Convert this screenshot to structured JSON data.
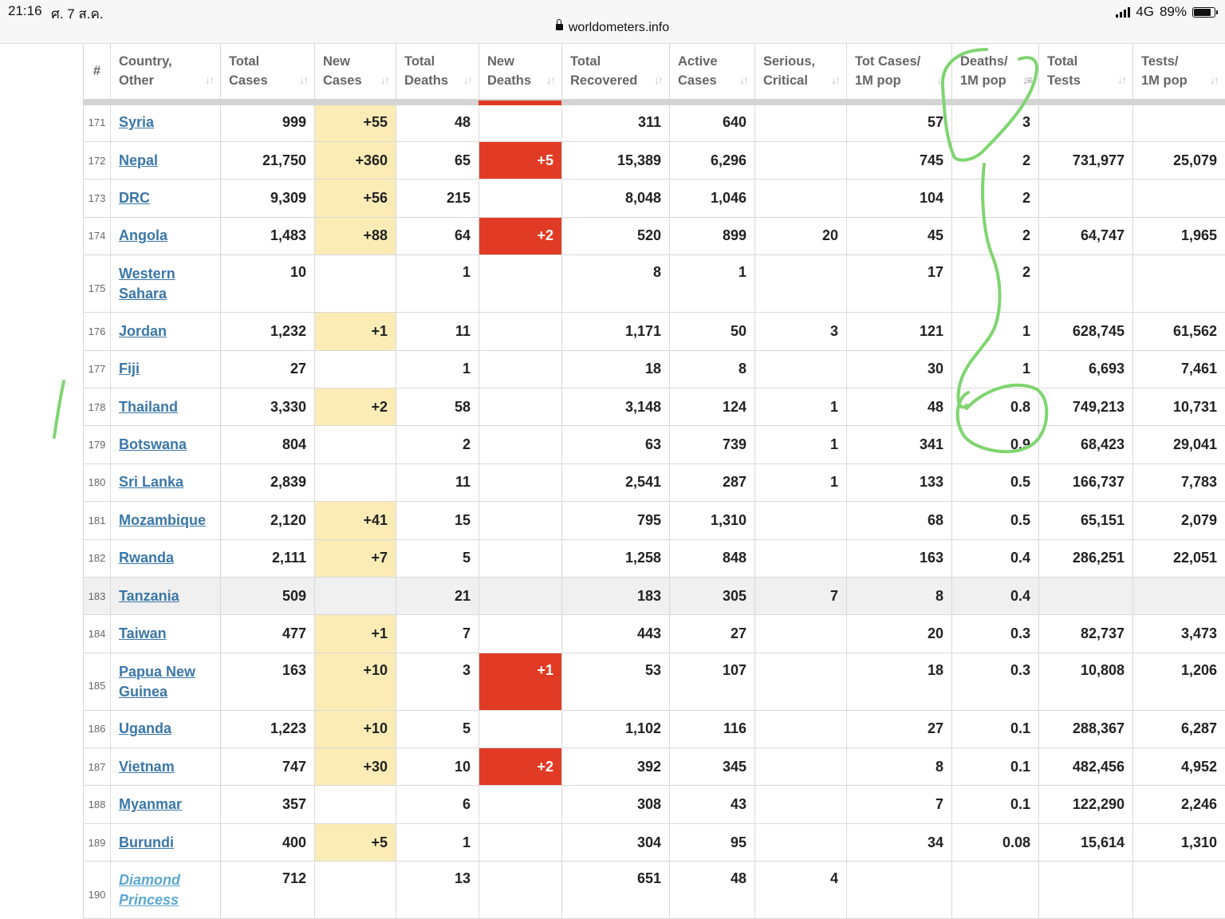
{
  "status": {
    "time": "21:16",
    "date": "ศ. 7 ส.ค.",
    "network": "4G",
    "battery": "89%",
    "battery_level": 0.89
  },
  "browser": {
    "url": "worldometers.info"
  },
  "table": {
    "columns": [
      {
        "lines": [
          "#"
        ]
      },
      {
        "lines": [
          "Country,",
          "Other"
        ]
      },
      {
        "lines": [
          "Total",
          "Cases"
        ]
      },
      {
        "lines": [
          "New",
          "Cases"
        ]
      },
      {
        "lines": [
          "Total",
          "Deaths"
        ]
      },
      {
        "lines": [
          "New",
          "Deaths"
        ]
      },
      {
        "lines": [
          "Total",
          "Recovered"
        ]
      },
      {
        "lines": [
          "Active",
          "Cases"
        ]
      },
      {
        "lines": [
          "Serious,",
          "Critical"
        ]
      },
      {
        "lines": [
          "Tot Cases/",
          "1M pop"
        ]
      },
      {
        "lines": [
          "Deaths/",
          "1M pop"
        ]
      },
      {
        "lines": [
          "Total",
          "Tests"
        ]
      },
      {
        "lines": [
          "Tests/",
          "1M pop"
        ]
      }
    ],
    "rows": [
      {
        "rank": "171",
        "country": "Syria",
        "total_cases": "999",
        "new_cases": "+55",
        "total_deaths": "48",
        "new_deaths": "",
        "total_recovered": "311",
        "active_cases": "640",
        "serious": "",
        "cases_per_m": "57",
        "deaths_per_m": "3",
        "total_tests": "",
        "tests_per_m": ""
      },
      {
        "rank": "172",
        "country": "Nepal",
        "total_cases": "21,750",
        "new_cases": "+360",
        "total_deaths": "65",
        "new_deaths": "+5",
        "total_recovered": "15,389",
        "active_cases": "6,296",
        "serious": "",
        "cases_per_m": "745",
        "deaths_per_m": "2",
        "total_tests": "731,977",
        "tests_per_m": "25,079"
      },
      {
        "rank": "173",
        "country": "DRC",
        "total_cases": "9,309",
        "new_cases": "+56",
        "total_deaths": "215",
        "new_deaths": "",
        "total_recovered": "8,048",
        "active_cases": "1,046",
        "serious": "",
        "cases_per_m": "104",
        "deaths_per_m": "2",
        "total_tests": "",
        "tests_per_m": ""
      },
      {
        "rank": "174",
        "country": "Angola",
        "total_cases": "1,483",
        "new_cases": "+88",
        "total_deaths": "64",
        "new_deaths": "+2",
        "total_recovered": "520",
        "active_cases": "899",
        "serious": "20",
        "cases_per_m": "45",
        "deaths_per_m": "2",
        "total_tests": "64,747",
        "tests_per_m": "1,965"
      },
      {
        "rank": "175",
        "country": "Western Sahara",
        "total_cases": "10",
        "new_cases": "",
        "total_deaths": "1",
        "new_deaths": "",
        "total_recovered": "8",
        "active_cases": "1",
        "serious": "",
        "cases_per_m": "17",
        "deaths_per_m": "2",
        "total_tests": "",
        "tests_per_m": ""
      },
      {
        "rank": "176",
        "country": "Jordan",
        "total_cases": "1,232",
        "new_cases": "+1",
        "total_deaths": "11",
        "new_deaths": "",
        "total_recovered": "1,171",
        "active_cases": "50",
        "serious": "3",
        "cases_per_m": "121",
        "deaths_per_m": "1",
        "total_tests": "628,745",
        "tests_per_m": "61,562"
      },
      {
        "rank": "177",
        "country": "Fiji",
        "total_cases": "27",
        "new_cases": "",
        "total_deaths": "1",
        "new_deaths": "",
        "total_recovered": "18",
        "active_cases": "8",
        "serious": "",
        "cases_per_m": "30",
        "deaths_per_m": "1",
        "total_tests": "6,693",
        "tests_per_m": "7,461"
      },
      {
        "rank": "178",
        "country": "Thailand",
        "total_cases": "3,330",
        "new_cases": "+2",
        "total_deaths": "58",
        "new_deaths": "",
        "total_recovered": "3,148",
        "active_cases": "124",
        "serious": "1",
        "cases_per_m": "48",
        "deaths_per_m": "0.8",
        "total_tests": "749,213",
        "tests_per_m": "10,731"
      },
      {
        "rank": "179",
        "country": "Botswana",
        "total_cases": "804",
        "new_cases": "",
        "total_deaths": "2",
        "new_deaths": "",
        "total_recovered": "63",
        "active_cases": "739",
        "serious": "1",
        "cases_per_m": "341",
        "deaths_per_m": "0.9",
        "total_tests": "68,423",
        "tests_per_m": "29,041"
      },
      {
        "rank": "180",
        "country": "Sri Lanka",
        "total_cases": "2,839",
        "new_cases": "",
        "total_deaths": "11",
        "new_deaths": "",
        "total_recovered": "2,541",
        "active_cases": "287",
        "serious": "1",
        "cases_per_m": "133",
        "deaths_per_m": "0.5",
        "total_tests": "166,737",
        "tests_per_m": "7,783"
      },
      {
        "rank": "181",
        "country": "Mozambique",
        "total_cases": "2,120",
        "new_cases": "+41",
        "total_deaths": "15",
        "new_deaths": "",
        "total_recovered": "795",
        "active_cases": "1,310",
        "serious": "",
        "cases_per_m": "68",
        "deaths_per_m": "0.5",
        "total_tests": "65,151",
        "tests_per_m": "2,079"
      },
      {
        "rank": "182",
        "country": "Rwanda",
        "total_cases": "2,111",
        "new_cases": "+7",
        "total_deaths": "5",
        "new_deaths": "",
        "total_recovered": "1,258",
        "active_cases": "848",
        "serious": "",
        "cases_per_m": "163",
        "deaths_per_m": "0.4",
        "total_tests": "286,251",
        "tests_per_m": "22,051"
      },
      {
        "rank": "183",
        "country": "Tanzania",
        "total_cases": "509",
        "new_cases": "",
        "total_deaths": "21",
        "new_deaths": "",
        "total_recovered": "183",
        "active_cases": "305",
        "serious": "7",
        "cases_per_m": "8",
        "deaths_per_m": "0.4",
        "total_tests": "",
        "tests_per_m": ""
      },
      {
        "rank": "184",
        "country": "Taiwan",
        "total_cases": "477",
        "new_cases": "+1",
        "total_deaths": "7",
        "new_deaths": "",
        "total_recovered": "443",
        "active_cases": "27",
        "serious": "",
        "cases_per_m": "20",
        "deaths_per_m": "0.3",
        "total_tests": "82,737",
        "tests_per_m": "3,473"
      },
      {
        "rank": "185",
        "country": "Papua New Guinea",
        "total_cases": "163",
        "new_cases": "+10",
        "total_deaths": "3",
        "new_deaths": "+1",
        "total_recovered": "53",
        "active_cases": "107",
        "serious": "",
        "cases_per_m": "18",
        "deaths_per_m": "0.3",
        "total_tests": "10,808",
        "tests_per_m": "1,206"
      },
      {
        "rank": "186",
        "country": "Uganda",
        "total_cases": "1,223",
        "new_cases": "+10",
        "total_deaths": "5",
        "new_deaths": "",
        "total_recovered": "1,102",
        "active_cases": "116",
        "serious": "",
        "cases_per_m": "27",
        "deaths_per_m": "0.1",
        "total_tests": "288,367",
        "tests_per_m": "6,287"
      },
      {
        "rank": "187",
        "country": "Vietnam",
        "total_cases": "747",
        "new_cases": "+30",
        "total_deaths": "10",
        "new_deaths": "+2",
        "total_recovered": "392",
        "active_cases": "345",
        "serious": "",
        "cases_per_m": "8",
        "deaths_per_m": "0.1",
        "total_tests": "482,456",
        "tests_per_m": "4,952"
      },
      {
        "rank": "188",
        "country": "Myanmar",
        "total_cases": "357",
        "new_cases": "",
        "total_deaths": "6",
        "new_deaths": "",
        "total_recovered": "308",
        "active_cases": "43",
        "serious": "",
        "cases_per_m": "7",
        "deaths_per_m": "0.1",
        "total_tests": "122,290",
        "tests_per_m": "2,246"
      },
      {
        "rank": "189",
        "country": "Burundi",
        "total_cases": "400",
        "new_cases": "+5",
        "total_deaths": "1",
        "new_deaths": "",
        "total_recovered": "304",
        "active_cases": "95",
        "serious": "",
        "cases_per_m": "34",
        "deaths_per_m": "0.08",
        "total_tests": "15,614",
        "tests_per_m": "1,310"
      },
      {
        "rank": "190",
        "country": "Diamond Princess",
        "total_cases": "712",
        "new_cases": "",
        "total_deaths": "13",
        "new_deaths": "",
        "total_recovered": "651",
        "active_cases": "48",
        "serious": "4",
        "cases_per_m": "",
        "deaths_per_m": "",
        "total_tests": "",
        "tests_per_m": ""
      }
    ]
  },
  "colors": {
    "new_cases_highlight": "#fbecb6",
    "new_deaths_highlight": "#e23b25",
    "country_link": "#3a77a8",
    "ship_link": "#5aa7d0",
    "annotation": "#7ed56f"
  }
}
